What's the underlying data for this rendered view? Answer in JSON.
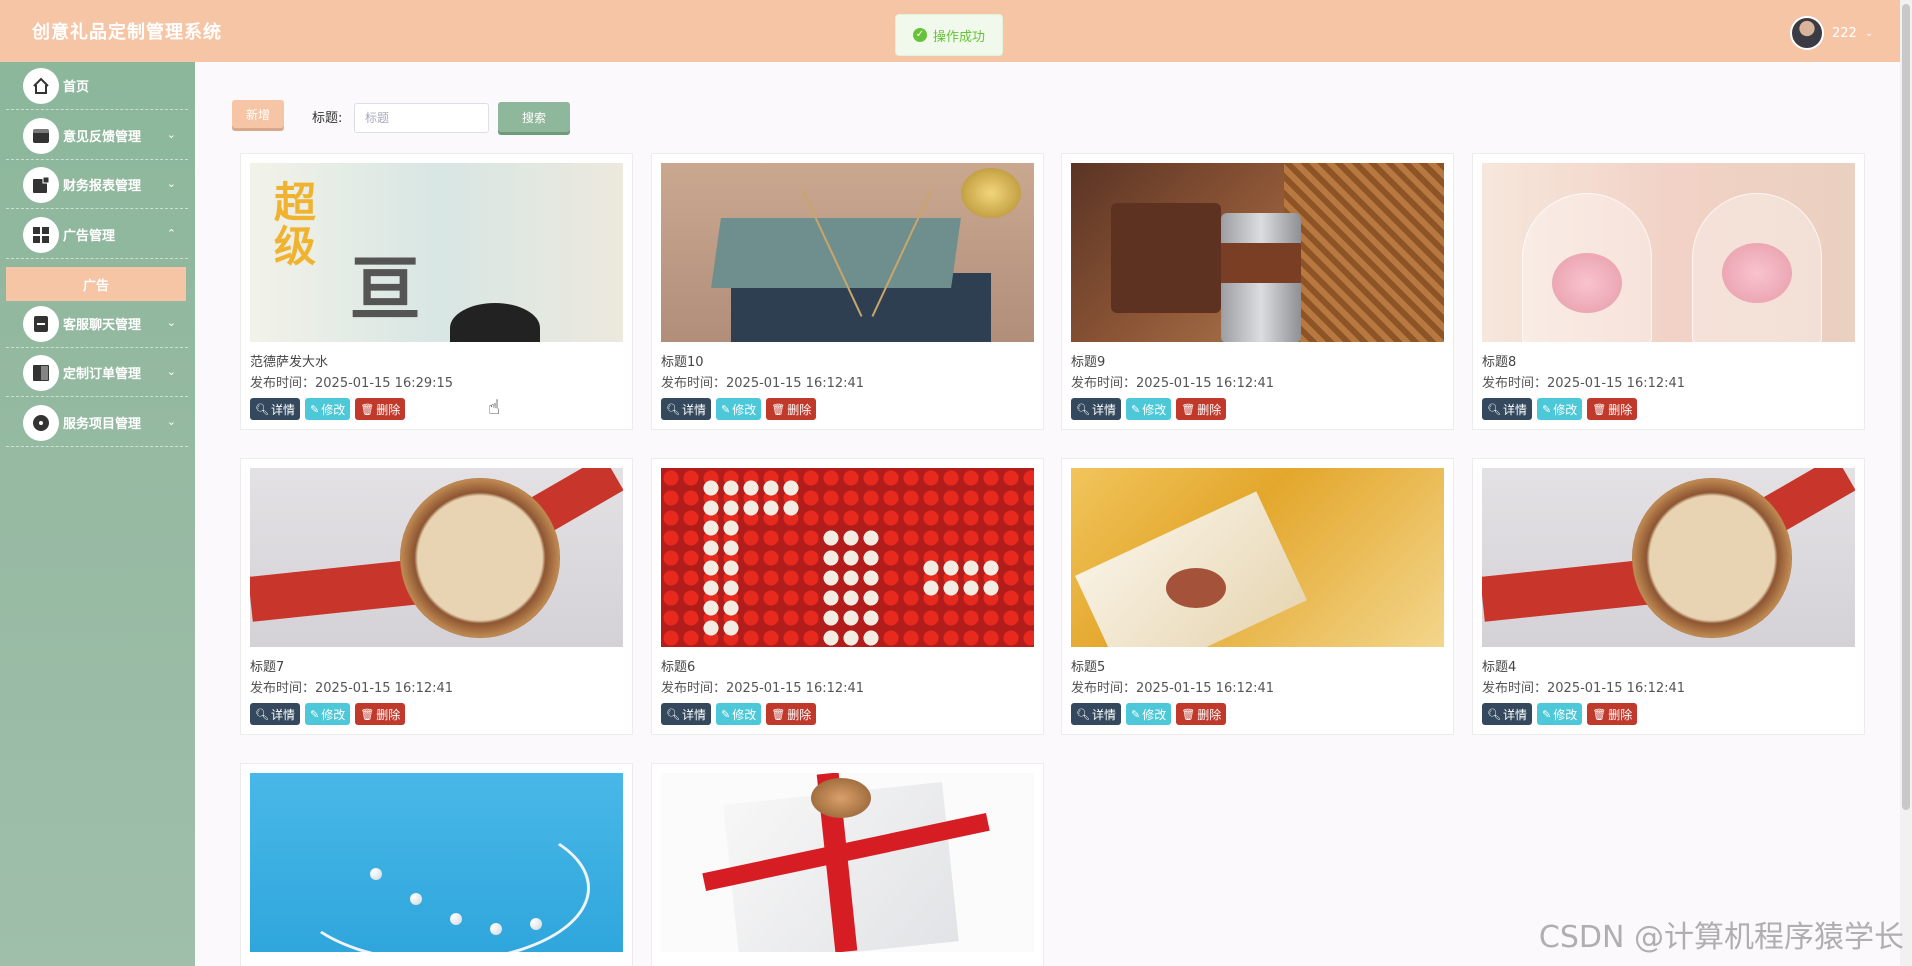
{
  "app": {
    "title": "创意礼品定制管理系统"
  },
  "toast": {
    "text": "操作成功",
    "icon": "success-check-icon",
    "color": "#67c23a"
  },
  "user": {
    "name": "222"
  },
  "colors": {
    "header": "#f6c5a5",
    "sidebar": "#8fb79b",
    "accent": "#f6c5a5"
  },
  "sidebar": {
    "items": [
      {
        "label": "首页",
        "icon": "home-icon",
        "expandable": false
      },
      {
        "label": "意见反馈管理",
        "icon": "feedback-icon",
        "expandable": true,
        "caret": "⌄"
      },
      {
        "label": "财务报表管理",
        "icon": "finance-icon",
        "expandable": true,
        "caret": "⌄"
      },
      {
        "label": "广告管理",
        "icon": "ad-icon",
        "expandable": true,
        "caret": "⌃"
      },
      {
        "label": "客服聊天管理",
        "icon": "chat-icon",
        "expandable": true,
        "caret": "⌄"
      },
      {
        "label": "定制订单管理",
        "icon": "order-icon",
        "expandable": true,
        "caret": "⌄"
      },
      {
        "label": "服务项目管理",
        "icon": "service-icon",
        "expandable": true,
        "caret": "⌄"
      }
    ],
    "submenu_active": "广告"
  },
  "toolbar": {
    "add_label": "新增",
    "search_label": "标题:",
    "search_placeholder": "标题",
    "search_button": "搜索"
  },
  "actions": {
    "detail": "详情",
    "edit": "修改",
    "delete": "删除"
  },
  "cards": [
    {
      "title": "范德萨发大水",
      "time": "发布时间：2025-01-15 16:29:15",
      "image": "poster"
    },
    {
      "title": "标题10",
      "time": "发布时间：2025-01-15 16:12:41",
      "image": "gift-box"
    },
    {
      "title": "标题9",
      "time": "发布时间：2025-01-15 16:12:41",
      "image": "coffee-set"
    },
    {
      "title": "标题8",
      "time": "发布时间：2025-01-15 16:12:41",
      "image": "rose-dome"
    },
    {
      "title": "标题7",
      "time": "发布时间：2025-01-15 16:12:41",
      "image": "watch"
    },
    {
      "title": "标题6",
      "time": "发布时间：2025-01-15 16:12:41",
      "image": "rose-box"
    },
    {
      "title": "标题5",
      "time": "发布时间：2025-01-15 16:12:41",
      "image": "golden-gift"
    },
    {
      "title": "标题4",
      "time": "发布时间：2025-01-15 16:12:41",
      "image": "watch"
    },
    {
      "title": "",
      "time": "",
      "image": "bracelet"
    },
    {
      "title": "",
      "time": "",
      "image": "red-ribbon-gift"
    }
  ],
  "watermark": "CSDN @计算机程序猿学长"
}
